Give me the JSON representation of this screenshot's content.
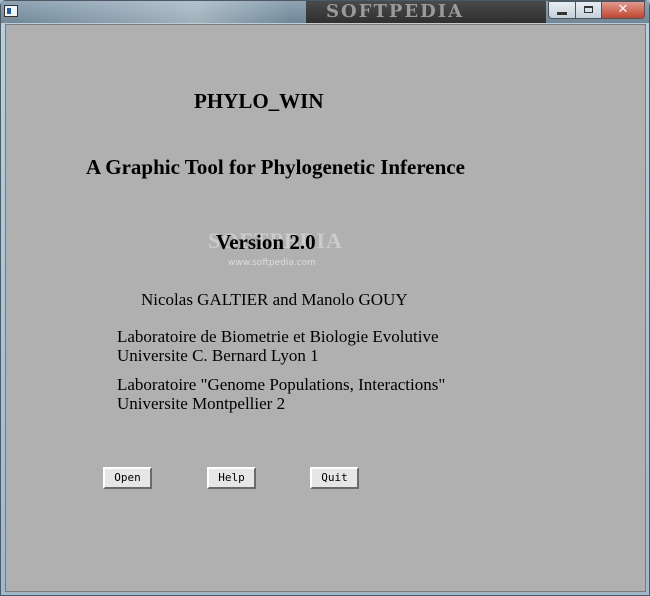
{
  "titlebar": {
    "watermark": "SOFTPEDIA",
    "minimize_icon": "minimize-icon",
    "maximize_icon": "maximize-icon",
    "close_icon": "close-icon",
    "close_glyph": "✕"
  },
  "about": {
    "app_name": "PHYLO_WIN",
    "subtitle": "A Graphic Tool for Phylogenetic Inference",
    "version": "Version 2.0",
    "authors": "Nicolas GALTIER and Manolo GOUY",
    "lab1_line1": "Laboratoire de Biometrie et Biologie Evolutive",
    "lab1_line2": "Universite C. Bernard  Lyon 1",
    "lab2_line1": "Laboratoire \"Genome Populations, Interactions\"",
    "lab2_line2": "Universite Montpellier 2",
    "overlay_mark": "SOFTPEDIA",
    "overlay_url": "www.softpedia.com"
  },
  "buttons": {
    "open": "Open",
    "help": "Help",
    "quit": "Quit"
  },
  "colors": {
    "client_background": "#b0b0b0",
    "button_face": "#e6e6e6",
    "close_button": "#c2452f"
  }
}
